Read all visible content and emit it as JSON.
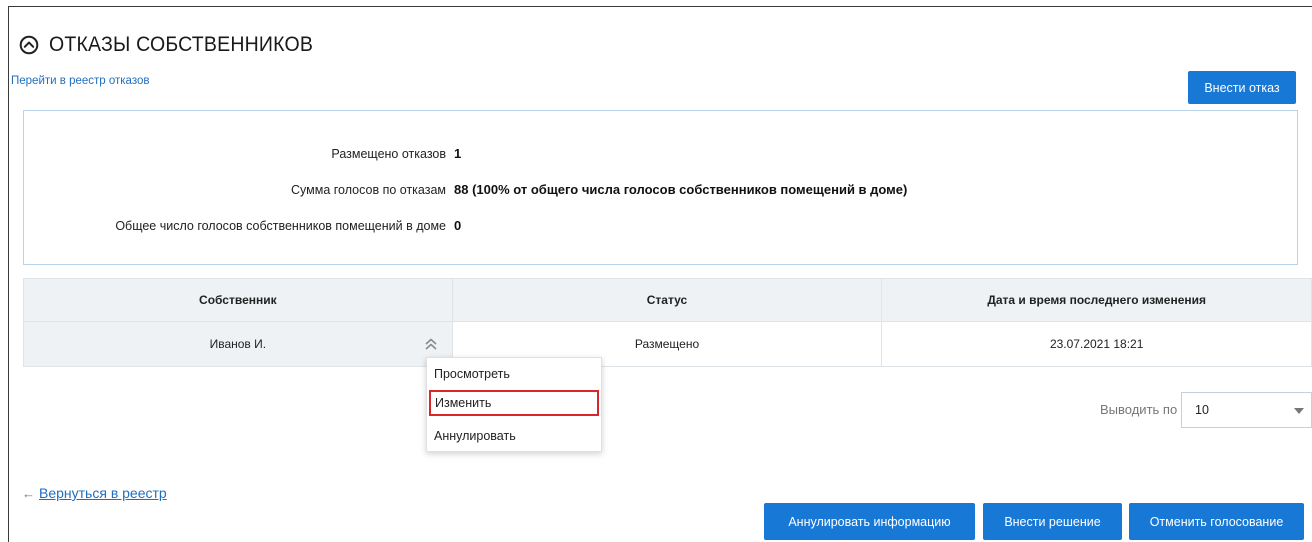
{
  "section": {
    "title": "ОТКАЗЫ СОБСТВЕННИКОВ",
    "collapse_icon": "chevron-up-circle-icon",
    "registry_link": "Перейти в реестр отказов",
    "add_refusal_button": "Внести отказ"
  },
  "summary": {
    "placed_label": "Размещено отказов",
    "placed_value": "1",
    "votes_sum_label": "Сумма голосов по отказам",
    "votes_sum_value": "88 (100% от общего числа голосов собственников помещений в доме)",
    "total_votes_label": "Общее число голосов собственников помещений в доме",
    "total_votes_value": "0"
  },
  "table": {
    "columns": [
      "Собственник",
      "Статус",
      "Дата и время последнего изменения"
    ],
    "rows": [
      {
        "owner": "Иванов И.",
        "status": "Размещено",
        "modified": "23.07.2021 18:21"
      }
    ]
  },
  "row_menu": {
    "items": [
      "Просмотреть",
      "Изменить",
      "Аннулировать"
    ],
    "highlighted": "Изменить"
  },
  "pagination": {
    "per_page_label": "Выводить по",
    "per_page_value": "10"
  },
  "footer": {
    "back_link": "Вернуться в реестр",
    "annul_info_button": "Аннулировать информацию",
    "add_decision_button": "Внести решение",
    "cancel_vote_button": "Отменить голосование"
  },
  "colors": {
    "accent": "#1878d6",
    "link": "#1f6fbf",
    "header_bg": "#eef2f5",
    "highlight_border": "#d9262c"
  }
}
